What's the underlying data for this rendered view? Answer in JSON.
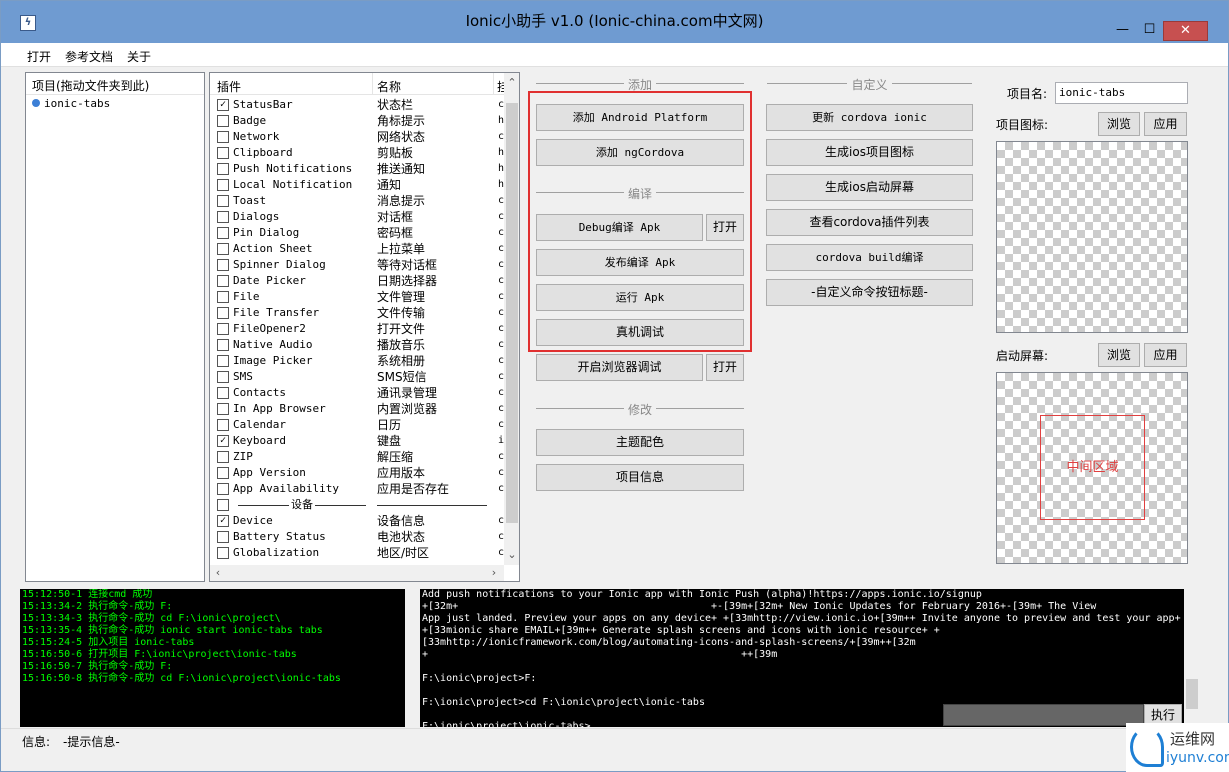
{
  "window": {
    "title": "Ionic小助手 v1.0 (Ionic-china.com中文网)",
    "min_symbol": "—",
    "max_symbol": "☐",
    "close_symbol": "✕",
    "icon_glyph": "ϟ"
  },
  "menu": [
    "打开",
    "参考文档",
    "关于"
  ],
  "project_panel": {
    "header": "项目(拖动文件夹到此)",
    "items": [
      "ionic-tabs"
    ]
  },
  "plugins": {
    "columns": [
      "插件",
      "名称",
      "挂"
    ],
    "rows": [
      {
        "name": "StatusBar",
        "cn": "状态栏",
        "v": "c",
        "checked": true
      },
      {
        "name": "Badge",
        "cn": "角标提示",
        "v": "h",
        "checked": false
      },
      {
        "name": "Network",
        "cn": "网络状态",
        "v": "c",
        "checked": false
      },
      {
        "name": "Clipboard",
        "cn": "剪贴板",
        "v": "h",
        "checked": false
      },
      {
        "name": "Push Notifications",
        "cn": "推送通知",
        "v": "h",
        "checked": false
      },
      {
        "name": "Local Notification",
        "cn": "通知",
        "v": "h",
        "checked": false
      },
      {
        "name": "Toast",
        "cn": "消息提示",
        "v": "c",
        "checked": false
      },
      {
        "name": "Dialogs",
        "cn": "对话框",
        "v": "c",
        "checked": false
      },
      {
        "name": "Pin Dialog",
        "cn": "密码框",
        "v": "c",
        "checked": false
      },
      {
        "name": "Action Sheet",
        "cn": "上拉菜单",
        "v": "c",
        "checked": false
      },
      {
        "name": "Spinner Dialog",
        "cn": "等待对话框",
        "v": "c",
        "checked": false
      },
      {
        "name": "Date Picker",
        "cn": "日期选择器",
        "v": "c",
        "checked": false
      },
      {
        "name": "File",
        "cn": "文件管理",
        "v": "c",
        "checked": false
      },
      {
        "name": "File Transfer",
        "cn": "文件传输",
        "v": "c",
        "checked": false
      },
      {
        "name": "FileOpener2",
        "cn": "打开文件",
        "v": "c",
        "checked": false
      },
      {
        "name": "Native Audio",
        "cn": "播放音乐",
        "v": "c",
        "checked": false
      },
      {
        "name": "Image Picker",
        "cn": "系统相册",
        "v": "c",
        "checked": false
      },
      {
        "name": "SMS",
        "cn": "SMS短信",
        "v": "c",
        "checked": false
      },
      {
        "name": "Contacts",
        "cn": "通讯录管理",
        "v": "c",
        "checked": false
      },
      {
        "name": "In App Browser",
        "cn": "内置浏览器",
        "v": "c",
        "checked": false
      },
      {
        "name": "Calendar",
        "cn": "日历",
        "v": "c",
        "checked": false
      },
      {
        "name": "Keyboard",
        "cn": "键盘",
        "v": "i",
        "checked": true
      },
      {
        "name": "ZIP",
        "cn": "解压缩",
        "v": "c",
        "checked": false
      },
      {
        "name": "App Version",
        "cn": "应用版本",
        "v": "c",
        "checked": false
      },
      {
        "name": "App Availability",
        "cn": "应用是否存在",
        "v": "c",
        "checked": false
      },
      {
        "name": "设备",
        "cn": "",
        "v": "",
        "checked": false,
        "separator": true
      },
      {
        "name": "Device",
        "cn": "设备信息",
        "v": "c",
        "checked": true
      },
      {
        "name": "Battery Status",
        "cn": "电池状态",
        "v": "c",
        "checked": false
      },
      {
        "name": "Globalization",
        "cn": "地区/时区",
        "v": "c",
        "checked": false
      }
    ]
  },
  "groups": {
    "add": "添加",
    "compile": "编译",
    "modify": "修改",
    "custom": "自定义"
  },
  "buttons": {
    "add_android": "添加 Android Platform",
    "add_ngcordova": "添加 ngCordova",
    "debug_apk": "Debug编译 Apk",
    "open1": "打开",
    "release_apk": "发布编译 Apk",
    "run_apk": "运行 Apk",
    "device_debug": "真机调试",
    "browser_debug": "开启浏览器调试",
    "open2": "打开",
    "theme": "主题配色",
    "project_info": "项目信息",
    "update_cordova": "更新 cordova ionic",
    "ios_icon": "生成ios项目图标",
    "ios_splash": "生成ios启动屏幕",
    "plugin_list": "查看cordova插件列表",
    "cordova_build": "cordova build编译",
    "custom_cmd": "-自定义命令按钮标题-"
  },
  "project_info": {
    "name_label": "项目名:",
    "name_value": "ionic-tabs",
    "icon_label": "项目图标:",
    "browse": "浏览",
    "apply": "应用",
    "splash_label": "启动屏幕:",
    "center_area": "中间区域"
  },
  "log": [
    "15:12:50-1 连接cmd 成功",
    "15:13:34-2 执行命令-成功 F:",
    "15:13:34-3 执行命令-成功 cd F:\\ionic\\project\\",
    "15:13:35-4 执行命令-成功 ionic start ionic-tabs tabs",
    "15:15:24-5 加入项目 ionic-tabs",
    "15:16:50-6 打开项目 F:\\ionic\\project\\ionic-tabs",
    "15:16:50-7 执行命令-成功 F:",
    "15:16:50-8 执行命令-成功 cd F:\\ionic\\project\\ionic-tabs"
  ],
  "console": [
    "Add push notifications to your Ionic app with Ionic Push (alpha)!https://apps.ionic.io/signup",
    "+[32m+                                          +-[39m+[32m+ New Ionic Updates for February 2016+-[39m+ The View",
    "App just landed. Preview your apps on any device+ +[33mhttp://view.ionic.io+[39m++ Invite anyone to preview and test your app+",
    "+[33mionic share EMAIL+[39m++ Generate splash screens and icons with ionic resource+ +",
    "[33mhttp://ionicframework.com/blog/automating-icons-and-splash-screens/+[39m++[32m",
    "+                                                    ++[39m",
    "",
    "F:\\ionic\\project>F:",
    "",
    "F:\\ionic\\project>cd F:\\ionic\\project\\ionic-tabs",
    "",
    "F:\\ionic\\project\\ionic-tabs>"
  ],
  "execute_button": "执行",
  "status": {
    "label": "信息:",
    "value": "-提示信息-"
  },
  "watermark": {
    "cn": "运维网",
    "en": "iyunv.com"
  }
}
